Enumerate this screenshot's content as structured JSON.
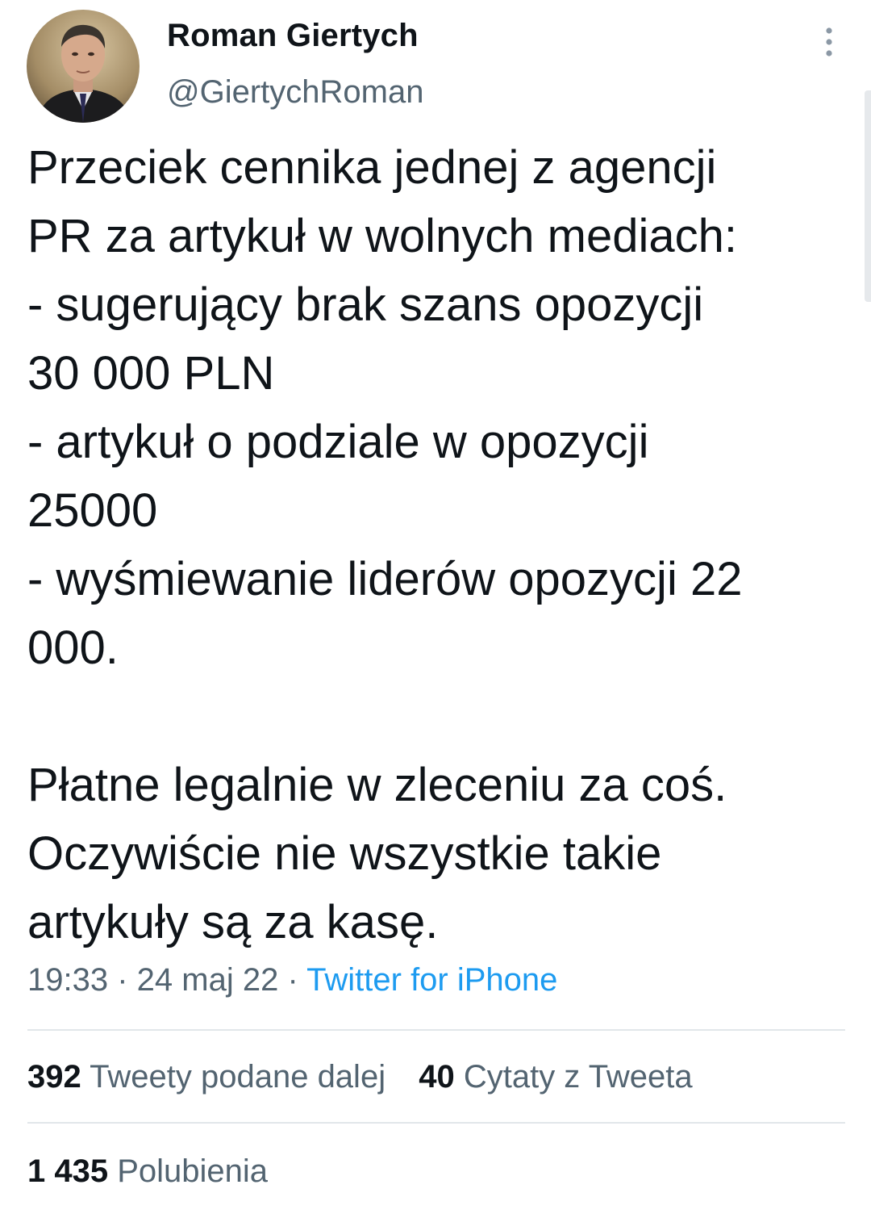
{
  "author": {
    "display_name": "Roman Giertych",
    "handle": "@GiertychRoman"
  },
  "tweet": {
    "lines": [
      "Przeciek cennika jednej z agencji",
      "PR za artykuł w wolnych mediach:",
      "- sugerujący brak szans opozycji",
      "30 000 PLN",
      "- artykuł o podziale w opozycji",
      "25000",
      "- wyśmiewanie liderów opozycji 22",
      "000.",
      "",
      "Płatne legalnie w zleceniu za coś.",
      "Oczywiście nie wszystkie takie",
      "artykuły są za kasę."
    ],
    "time": "19:33",
    "date": "24 maj 22",
    "separator": " · ",
    "source": "Twitter for iPhone"
  },
  "stats": {
    "retweets_count": "392",
    "retweets_label": "Tweety podane dalej",
    "quotes_count": "40",
    "quotes_label": "Cytaty z Tweeta",
    "likes_count": "1 435",
    "likes_label": "Polubienia"
  },
  "icons": {
    "avatar": "profile-photo",
    "more": "vertical-ellipsis-icon"
  },
  "colors": {
    "text_primary": "#0f1419",
    "text_secondary": "#536471",
    "link": "#1d9bf0",
    "divider": "#e1e6ea"
  }
}
